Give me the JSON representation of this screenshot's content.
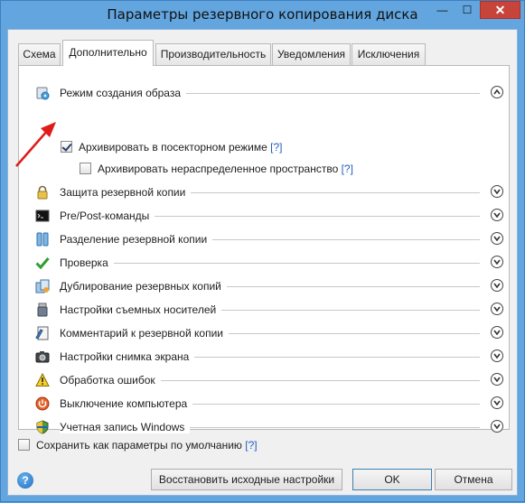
{
  "window": {
    "title": "Параметры резервного копирования диска",
    "minimize": "—",
    "maximize": "☐",
    "close": "✕"
  },
  "tabs": [
    {
      "label": "Схема"
    },
    {
      "label": "Дополнительно"
    },
    {
      "label": "Производительность"
    },
    {
      "label": "Уведомления"
    },
    {
      "label": "Исключения"
    }
  ],
  "image_mode": {
    "label": "Режим создания образа",
    "sector_by_sector": {
      "label": "Архивировать в посекторном режиме",
      "help": "[?]",
      "checked": true
    },
    "unallocated": {
      "label": "Архивировать нераспределенное пространство",
      "help": "[?]",
      "checked": false
    }
  },
  "sections": [
    {
      "label": "Защита резервной копии",
      "icon": "lock-icon"
    },
    {
      "label": "Pre/Post-команды",
      "icon": "terminal-icon"
    },
    {
      "label": "Разделение резервной копии",
      "icon": "split-icon"
    },
    {
      "label": "Проверка",
      "icon": "check-icon"
    },
    {
      "label": "Дублирование резервных копий",
      "icon": "duplicate-icon"
    },
    {
      "label": "Настройки съемных носителей",
      "icon": "usb-icon"
    },
    {
      "label": "Комментарий к резервной копии",
      "icon": "comment-icon"
    },
    {
      "label": "Настройки снимка экрана",
      "icon": "camera-icon"
    },
    {
      "label": "Обработка ошибок",
      "icon": "warning-icon"
    },
    {
      "label": "Выключение компьютера",
      "icon": "power-icon"
    },
    {
      "label": "Учетная запись Windows",
      "icon": "shield-icon"
    }
  ],
  "footer": {
    "save_default": {
      "label": "Сохранить как параметры по умолчанию",
      "help": "[?]",
      "checked": false
    },
    "help_glyph": "?",
    "restore_label": "Восстановить исходные настройки",
    "ok_label": "OK",
    "cancel_label": "Отмена"
  },
  "colors": {
    "accent": "#1f5fbf",
    "titlebar": "#62a5df",
    "close": "#c7443b",
    "annotation_arrow": "#e01b1b"
  }
}
